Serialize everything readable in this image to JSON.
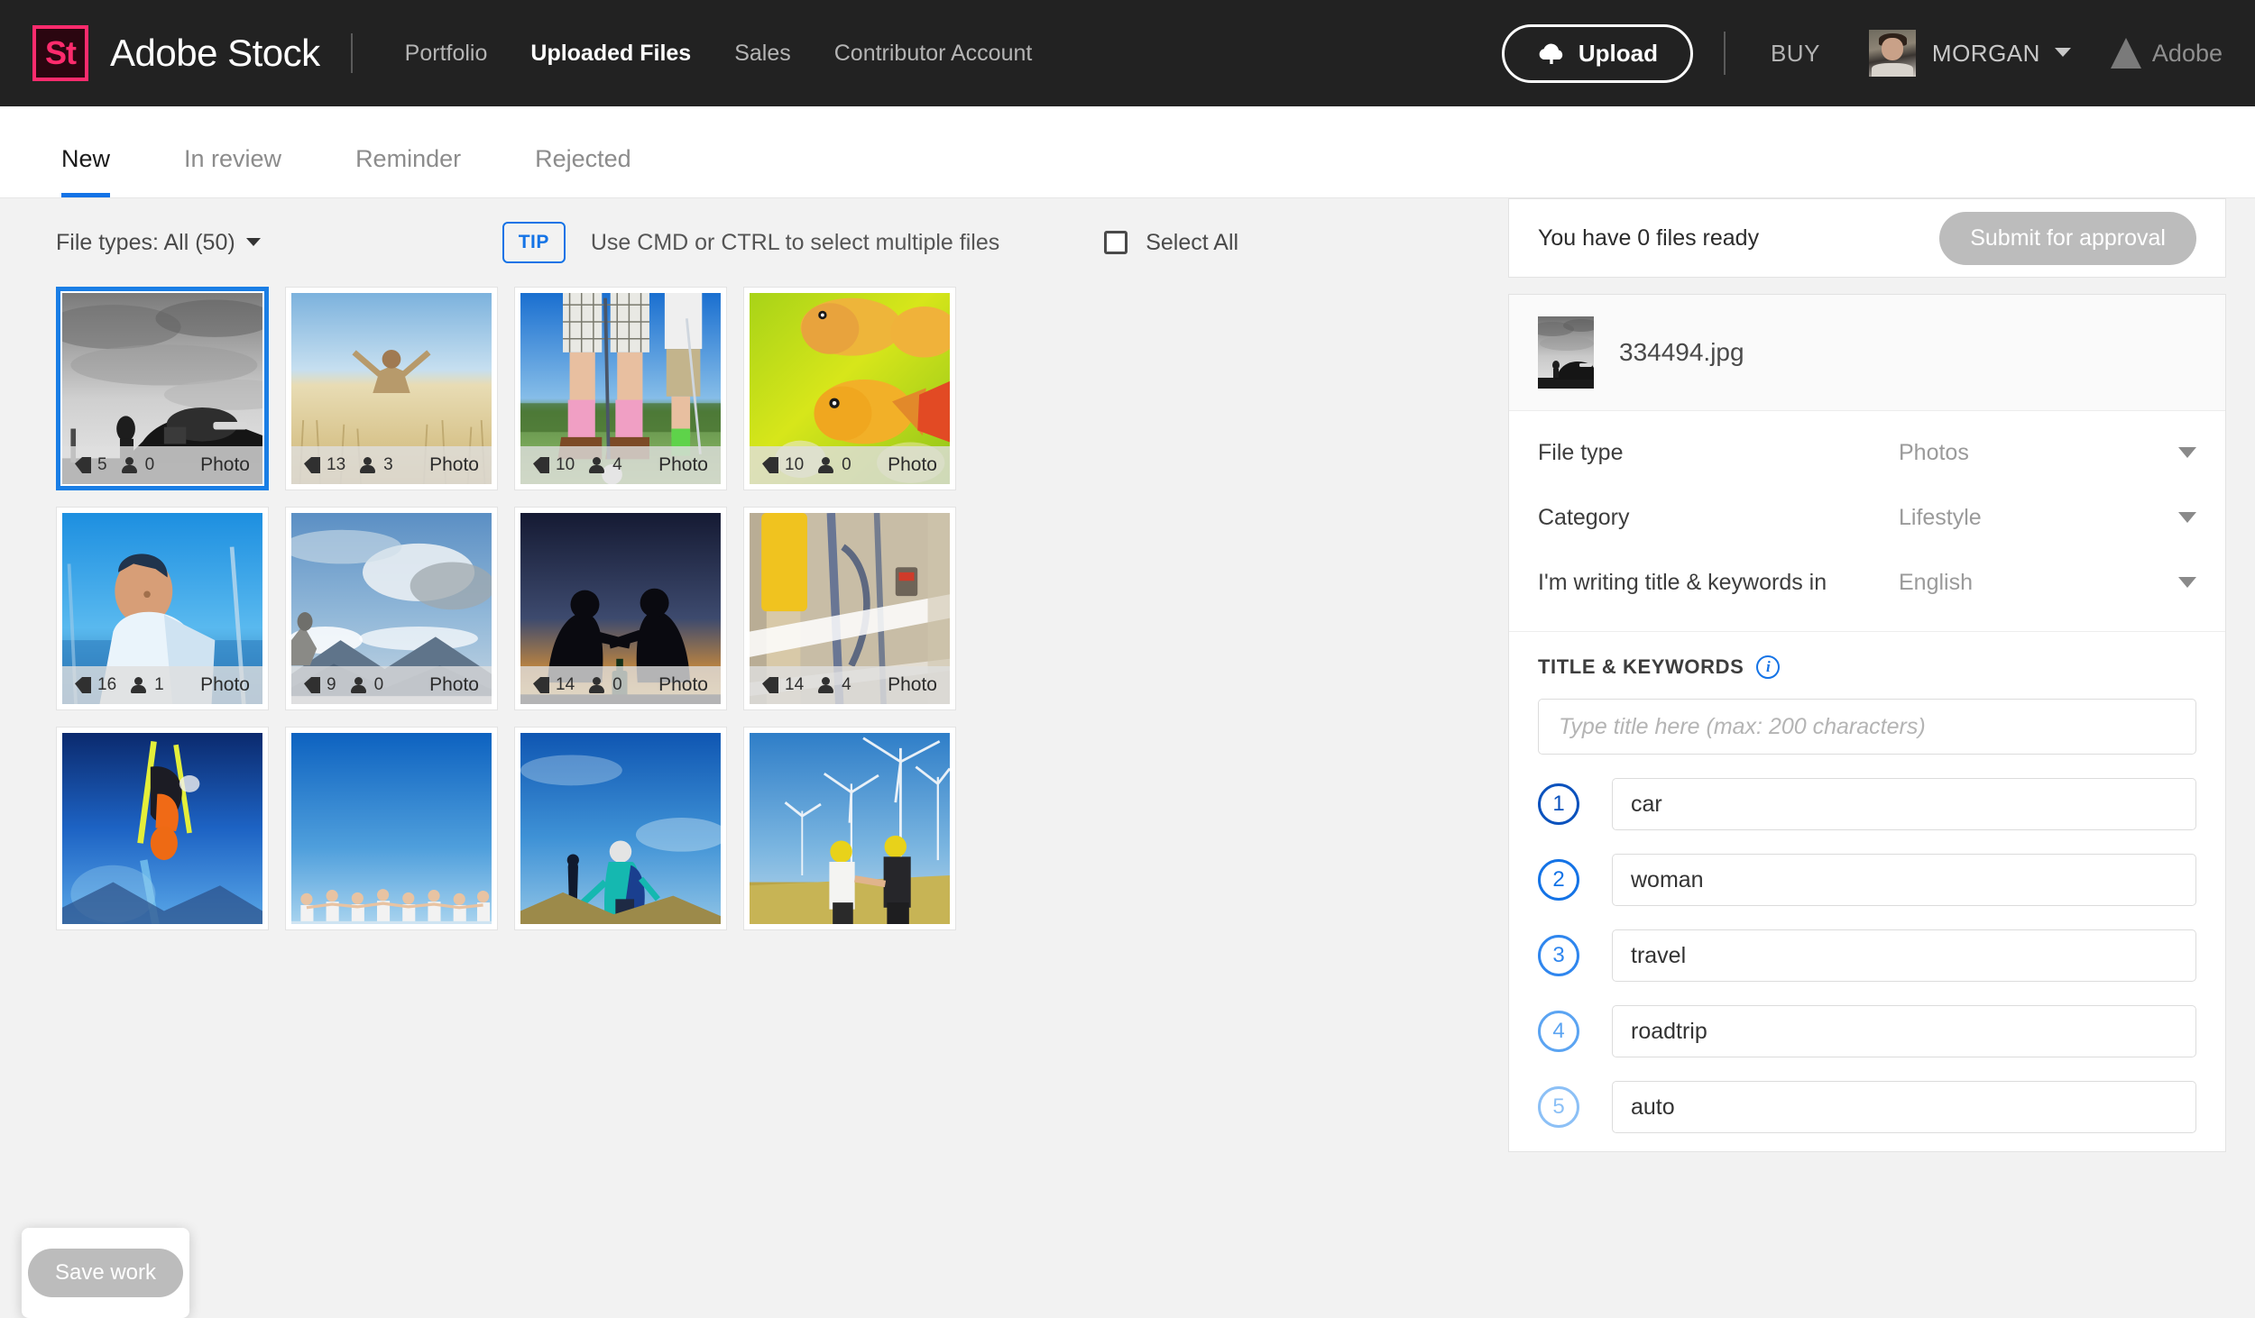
{
  "header": {
    "logo_text": "St",
    "brand": "Adobe Stock",
    "nav": [
      {
        "label": "Portfolio",
        "active": false
      },
      {
        "label": "Uploaded Files",
        "active": true
      },
      {
        "label": "Sales",
        "active": false
      },
      {
        "label": "Contributor Account",
        "active": false
      }
    ],
    "upload_label": "Upload",
    "buy_label": "BUY",
    "username": "MORGAN",
    "adobe_label": "Adobe"
  },
  "tabs": [
    {
      "label": "New",
      "active": true
    },
    {
      "label": "In review",
      "active": false
    },
    {
      "label": "Reminder",
      "active": false
    },
    {
      "label": "Rejected",
      "active": false
    }
  ],
  "toolbar": {
    "file_types_label": "File types: All (50)",
    "tip_badge": "TIP",
    "tip_text": "Use CMD or CTRL to select multiple files",
    "select_all_label": "Select All"
  },
  "grid": {
    "cards": [
      {
        "keywords": "5",
        "releases": "0",
        "type": "Photo",
        "scene": "bw-car",
        "selected": true
      },
      {
        "keywords": "13",
        "releases": "3",
        "type": "Photo",
        "scene": "wheat",
        "selected": false
      },
      {
        "keywords": "10",
        "releases": "4",
        "type": "Photo",
        "scene": "golf",
        "selected": false
      },
      {
        "keywords": "10",
        "releases": "0",
        "type": "Photo",
        "scene": "fish",
        "selected": false
      },
      {
        "keywords": "16",
        "releases": "1",
        "type": "Photo",
        "scene": "sailing",
        "selected": false
      },
      {
        "keywords": "9",
        "releases": "0",
        "type": "Photo",
        "scene": "mountain",
        "selected": false
      },
      {
        "keywords": "14",
        "releases": "0",
        "type": "Photo",
        "scene": "campfire",
        "selected": false
      },
      {
        "keywords": "14",
        "releases": "4",
        "type": "Photo",
        "scene": "graffiti",
        "selected": false
      },
      {
        "keywords": "",
        "releases": "",
        "type": "",
        "scene": "ski",
        "selected": false
      },
      {
        "keywords": "",
        "releases": "",
        "type": "",
        "scene": "people",
        "selected": false
      },
      {
        "keywords": "",
        "releases": "",
        "type": "",
        "scene": "hiker",
        "selected": false
      },
      {
        "keywords": "",
        "releases": "",
        "type": "",
        "scene": "turbine",
        "selected": false
      }
    ]
  },
  "save_work": {
    "label": "Save work",
    "enabled": false
  },
  "right_panel": {
    "ready_text": "You have 0 files ready",
    "submit_label": "Submit for approval",
    "submit_enabled": false,
    "file_name": "334494.jpg",
    "meta_rows": [
      {
        "label": "File type",
        "value": "Photos"
      },
      {
        "label": "Category",
        "value": "Lifestyle"
      },
      {
        "label": "I'm writing title & keywords in",
        "value": "English"
      }
    ],
    "keywords_section": {
      "heading": "TITLE & KEYWORDS",
      "info_icon": "i",
      "title_placeholder": "Type title here (max: 200 characters)",
      "title_value": "",
      "keywords": [
        {
          "index": "1",
          "value": "car"
        },
        {
          "index": "2",
          "value": "woman"
        },
        {
          "index": "3",
          "value": "travel"
        },
        {
          "index": "4",
          "value": "roadtrip"
        },
        {
          "index": "5",
          "value": "auto"
        }
      ]
    }
  },
  "colors": {
    "accent_blue": "#1473e6",
    "select_blue": "#1a7ee5",
    "brand_pink": "#ff2b6d",
    "header_dark": "#222222",
    "disabled_gray": "#bcbcbc"
  }
}
